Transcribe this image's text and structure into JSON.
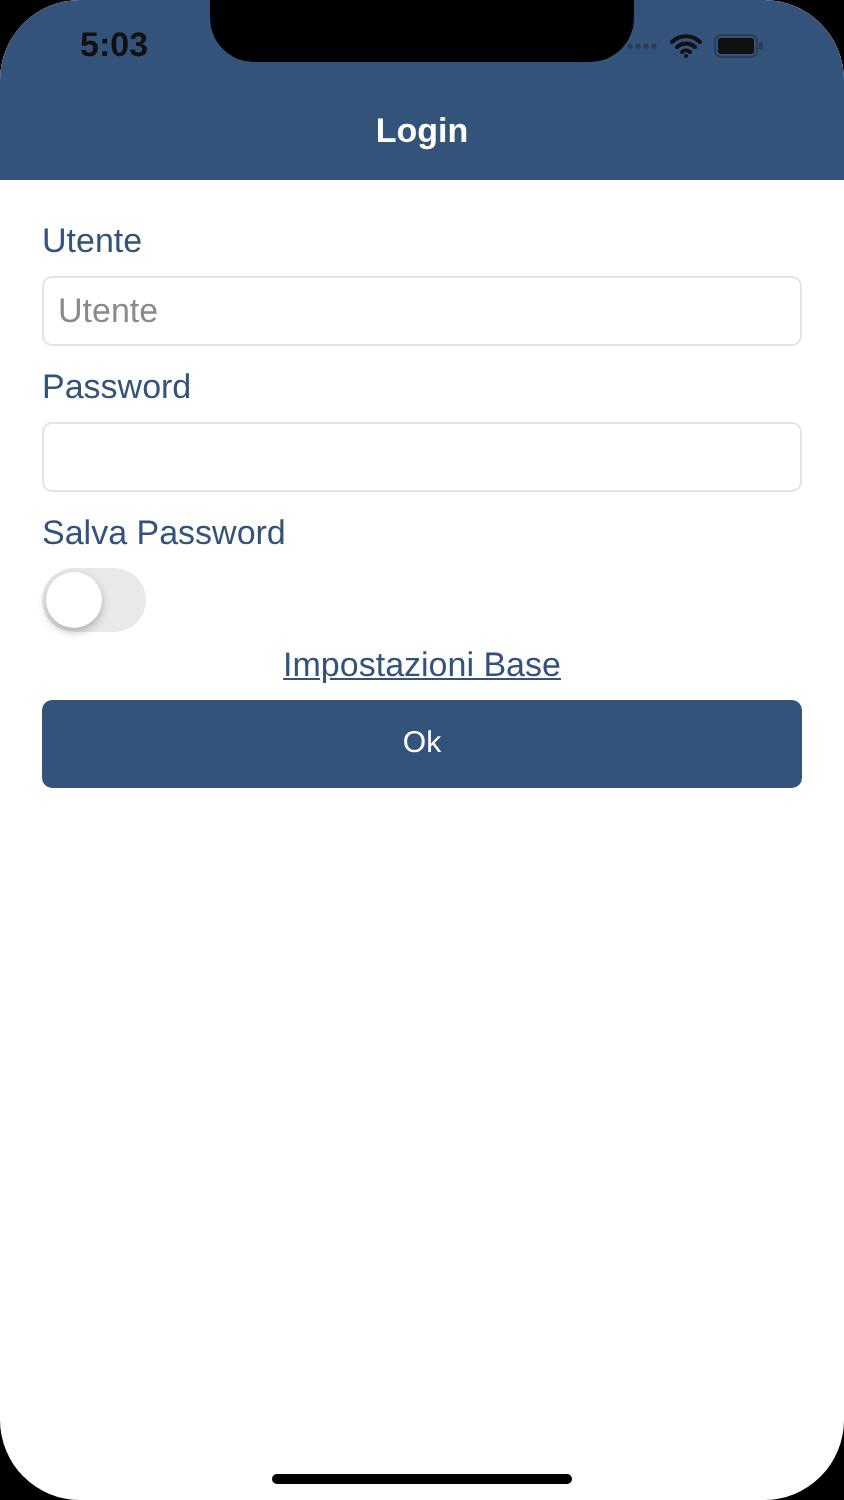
{
  "status_bar": {
    "time": "5:03"
  },
  "nav": {
    "title": "Login"
  },
  "fields": [
    {
      "label": "Utente",
      "placeholder": "Utente"
    },
    {
      "label": "Password"
    }
  ],
  "save_password": {
    "label": "Salva Password",
    "on": false
  },
  "link": "Impostazioni Base",
  "button": "Ok"
}
